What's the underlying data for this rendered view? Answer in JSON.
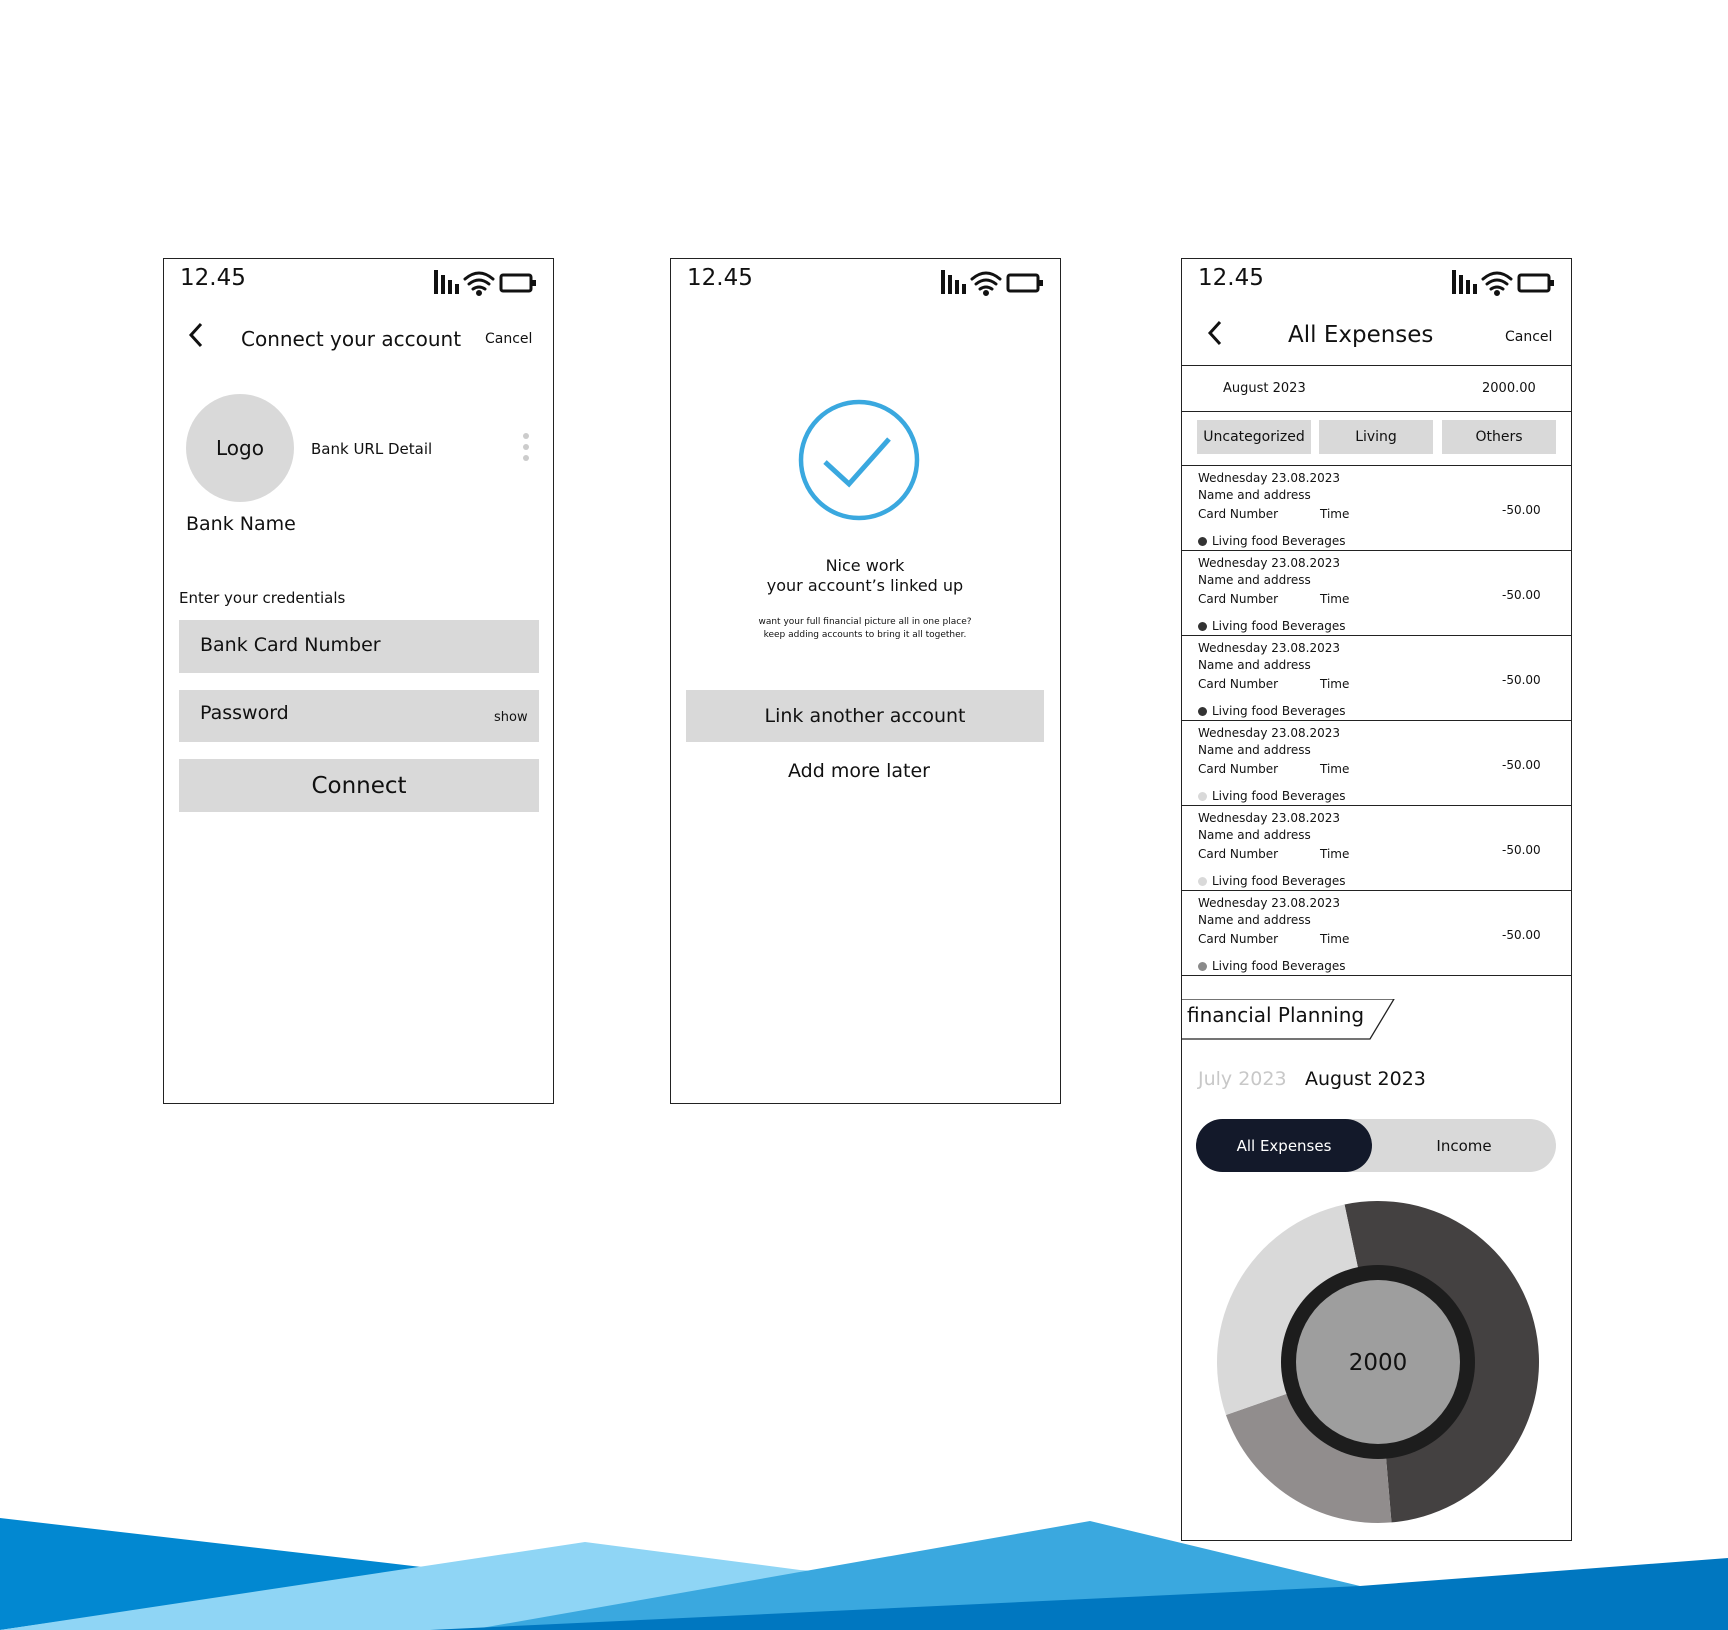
{
  "status_bar": {
    "time": "12.45"
  },
  "screen1": {
    "title": "Connect your account",
    "cancel": "Cancel",
    "logo": "Logo",
    "bank_url": "Bank URL Detail",
    "bank_name": "Bank Name",
    "credentials_label": "Enter your credentials",
    "card_placeholder": "Bank Card Number",
    "password_placeholder": "Password",
    "show_label": "show",
    "connect_label": "Connect"
  },
  "screen2": {
    "headline_line1": "Nice work",
    "headline_line2": "your account’s linked up",
    "sub_line1": "want your full financial picture all in one place?",
    "sub_line2": "keep adding accounts to bring it all together.",
    "link_button": "Link another account",
    "later_link": "Add more later",
    "check_color": "#3aa8df"
  },
  "screen3": {
    "title": "All Expenses",
    "cancel": "Cancel",
    "month": "August 2023",
    "total": "2000.00",
    "chips": [
      "Uncategorized",
      "Living",
      "Others"
    ],
    "transactions": [
      {
        "date": "Wednesday 23.08.2023",
        "name": "Name and address",
        "card": "Card Number",
        "time": "Time",
        "amount": "-50.00",
        "category": "Living food Beverages",
        "dot_color": "#333333"
      },
      {
        "date": "Wednesday 23.08.2023",
        "name": "Name and address",
        "card": "Card Number",
        "time": "Time",
        "amount": "-50.00",
        "category": "Living food Beverages",
        "dot_color": "#333333"
      },
      {
        "date": "Wednesday 23.08.2023",
        "name": "Name and address",
        "card": "Card Number",
        "time": "Time",
        "amount": "-50.00",
        "category": "Living food Beverages",
        "dot_color": "#333333"
      },
      {
        "date": "Wednesday 23.08.2023",
        "name": "Name and address",
        "card": "Card Number",
        "time": "Time",
        "amount": "-50.00",
        "category": "Living food Beverages",
        "dot_color": "#d9d9d9"
      },
      {
        "date": "Wednesday 23.08.2023",
        "name": "Name and address",
        "card": "Card Number",
        "time": "Time",
        "amount": "-50.00",
        "category": "Living food Beverages",
        "dot_color": "#d9d9d9"
      },
      {
        "date": "Wednesday 23.08.2023",
        "name": "Name and address",
        "card": "Card Number",
        "time": "Time",
        "amount": "-50.00",
        "category": "Living food Beverages",
        "dot_color": "#8a8a8a"
      }
    ],
    "planning_tab": "financial Planning",
    "prev_month": "July 2023",
    "current_month": "August 2023",
    "toggle_active": "All Expenses",
    "toggle_inactive": "Income",
    "donut_center": "2000"
  },
  "chart_data": {
    "type": "pie",
    "center_label": "2000",
    "series": [
      {
        "value": 52,
        "color": "#444141"
      },
      {
        "value": 21,
        "color": "#918d8d"
      },
      {
        "value": 27,
        "color": "#d9d9d9"
      }
    ]
  }
}
